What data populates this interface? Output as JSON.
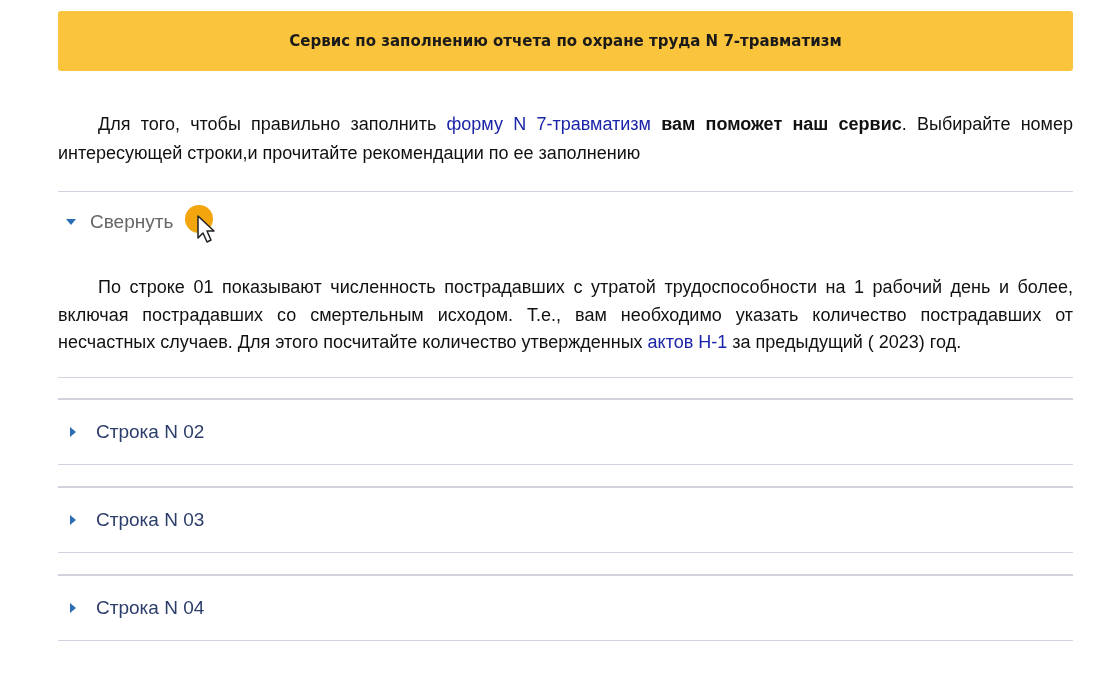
{
  "header": {
    "title": "Сервис по заполнению отчета по охране труда N 7-травматизм"
  },
  "intro": {
    "before": "Для того, чтобы правильно заполнить ",
    "link": "форму N 7-травматизм",
    "after": " **вам поможет наш сервис**. Выбирайте номер интересующей строки,и прочитайте рекомендации по ее заполнению"
  },
  "sections": [
    {
      "label": "Свернуть",
      "expanded": true,
      "body": {
        "before": "По строке 01 показывают численность пострадавших с утратой трудоспособности на 1 рабочий день и более, включая пострадавших со смертельным исходом. Т.е., вам необходимо указать количество пострадавших от несчастных случаев. Для этого посчитайте количество утвержденных ",
        "link": "актов Н-1",
        "after": " за предыдущий ( 2023) год."
      }
    },
    {
      "label": "Строка N 02",
      "expanded": false
    },
    {
      "label": "Строка N 03",
      "expanded": false
    },
    {
      "label": "Строка N 04",
      "expanded": false
    }
  ]
}
